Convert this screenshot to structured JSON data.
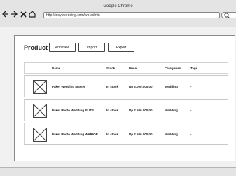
{
  "window": {
    "title": "Google Chrome"
  },
  "toolbar": {
    "back_icon": "back-arrow-icon",
    "forward_icon": "forward-arrow-icon",
    "close_icon": "close-x-icon",
    "home_icon": "home-icon",
    "url": "http://idoyswedding.com/wp-admin"
  },
  "page": {
    "title": "Product",
    "buttons": {
      "add_new": "Add New",
      "import": "Import",
      "export": "Export"
    }
  },
  "table": {
    "headers": {
      "name": "Name",
      "stock": "Stock",
      "price": "Price",
      "categories": "Categories",
      "tags": "Tags"
    },
    "rows": [
      {
        "name": "Paket Wedding Master",
        "stock": "In stock",
        "price": "Rp 3.000.000,00",
        "category": "Wedding",
        "tags": "-"
      },
      {
        "name": "Paket Photo Wedding ELITE",
        "stock": "In stock",
        "price": "Rp 2.500.000,00",
        "category": "Wedding",
        "tags": "-"
      },
      {
        "name": "Paket Photo Wedding WARIOR",
        "stock": "In stock",
        "price": "Rp 2.500.000,00",
        "category": "Wedding",
        "tags": "-"
      }
    ]
  }
}
